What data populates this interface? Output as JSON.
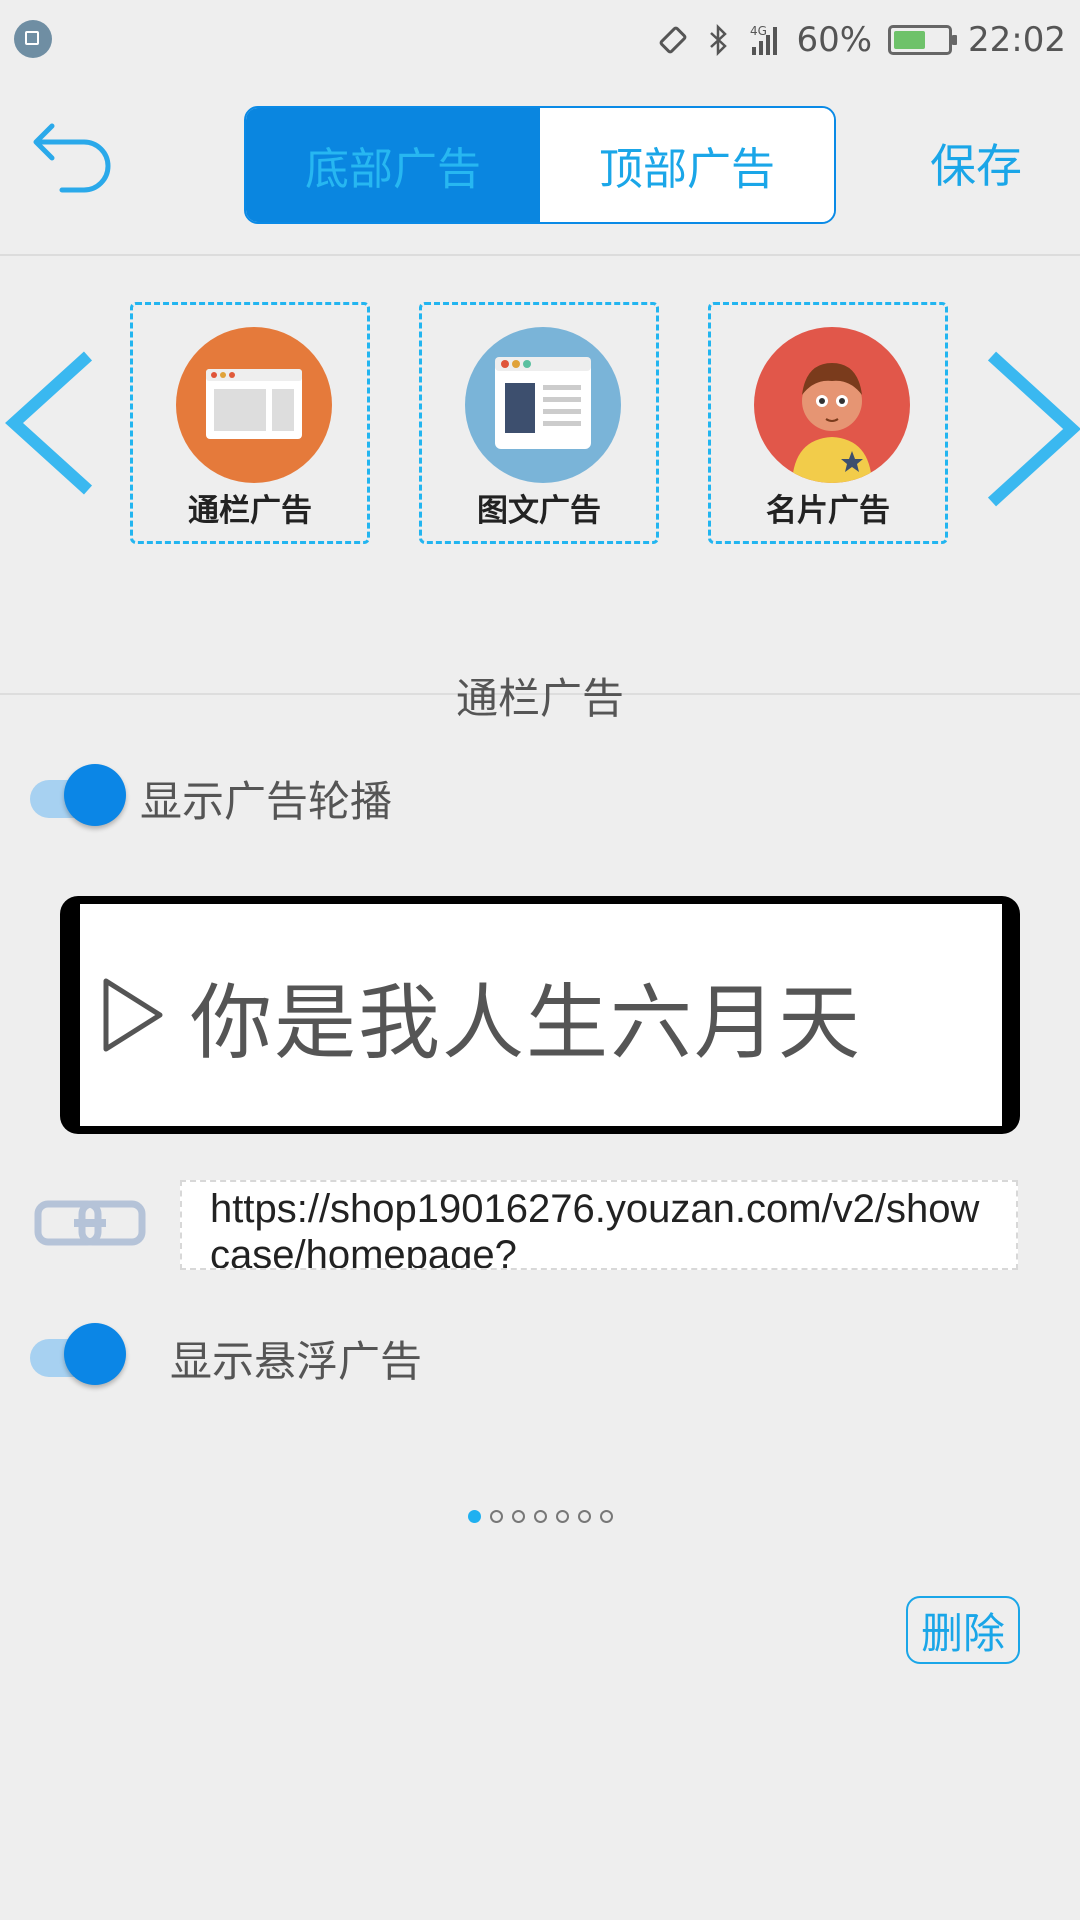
{
  "status_bar": {
    "battery_percent": "60%",
    "battery_level": 0.6,
    "time": "22:02",
    "network": "4G",
    "icons": [
      "screenshot-icon",
      "rotation-lock-icon",
      "bluetooth-icon",
      "signal-4g-icon",
      "battery-icon"
    ]
  },
  "header": {
    "tabs": [
      {
        "label": "底部广告",
        "active": true
      },
      {
        "label": "顶部广告",
        "active": false
      }
    ],
    "save_label": "保存"
  },
  "templates": [
    {
      "label": "通栏广告",
      "color": "#e57a3b",
      "icon": "banner-ad-icon"
    },
    {
      "label": "图文广告",
      "color": "#7ab4d8",
      "icon": "image-text-ad-icon"
    },
    {
      "label": "名片广告",
      "color": "#e1574a",
      "icon": "business-card-ad-icon"
    }
  ],
  "section": {
    "title": "通栏广告"
  },
  "carousel_toggle": {
    "label": "显示广告轮播",
    "on": true
  },
  "banner": {
    "text": "你是我人生六月天"
  },
  "link": {
    "url": "https://shop19016276.youzan.com/v2/showcase/homepage?"
  },
  "float_toggle": {
    "label": "显示悬浮广告",
    "on": true
  },
  "pagination": {
    "total": 7,
    "current": 1
  },
  "delete_label": "删除",
  "colors": {
    "accent": "#1aa6e8",
    "primary": "#0a86e0",
    "background": "#eeeeee"
  }
}
